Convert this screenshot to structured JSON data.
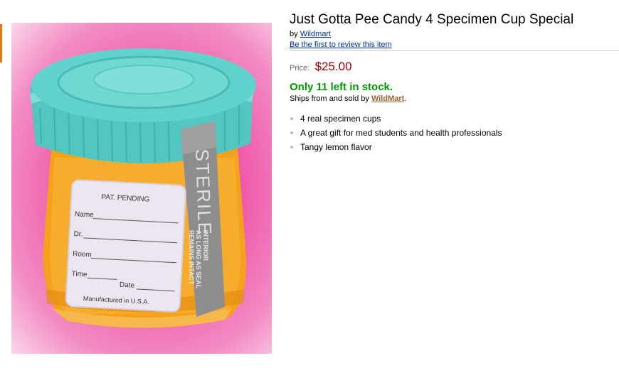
{
  "product": {
    "title": "Just Gotta Pee Candy 4 Specimen Cup Special",
    "by_prefix": "by",
    "brand": "Wildmart",
    "review_link": "Be the first to review this item",
    "price_label": "Price:",
    "price": "$25.00",
    "stock": "Only 11 left in stock.",
    "ships_prefix": "Ships from and sold by",
    "seller": "WildMart",
    "ships_suffix": ".",
    "bullets": [
      "4 real specimen cups",
      "A great gift for med students and health professionals",
      "Tangy lemon flavor"
    ]
  },
  "image_label": {
    "pat": "PAT. PENDING",
    "name": "Name",
    "dr": "Dr.",
    "room": "Room",
    "time": "Time",
    "date": "Date",
    "manufactured": "Manufactured in U.S.A.",
    "seal_big": "STERILE",
    "seal_small_1": "INTERIOR",
    "seal_small_2": "AS LONG AS SEAL",
    "seal_small_3": "REMAINS INTACT"
  },
  "colors": {
    "title": "#000000",
    "link": "#003399",
    "price": "#990000",
    "stock": "#009900",
    "seller": "#996633",
    "background_pink": "#ee3f9b",
    "lid_teal": "#5ccfc9",
    "liquid": "#f4a21c"
  }
}
